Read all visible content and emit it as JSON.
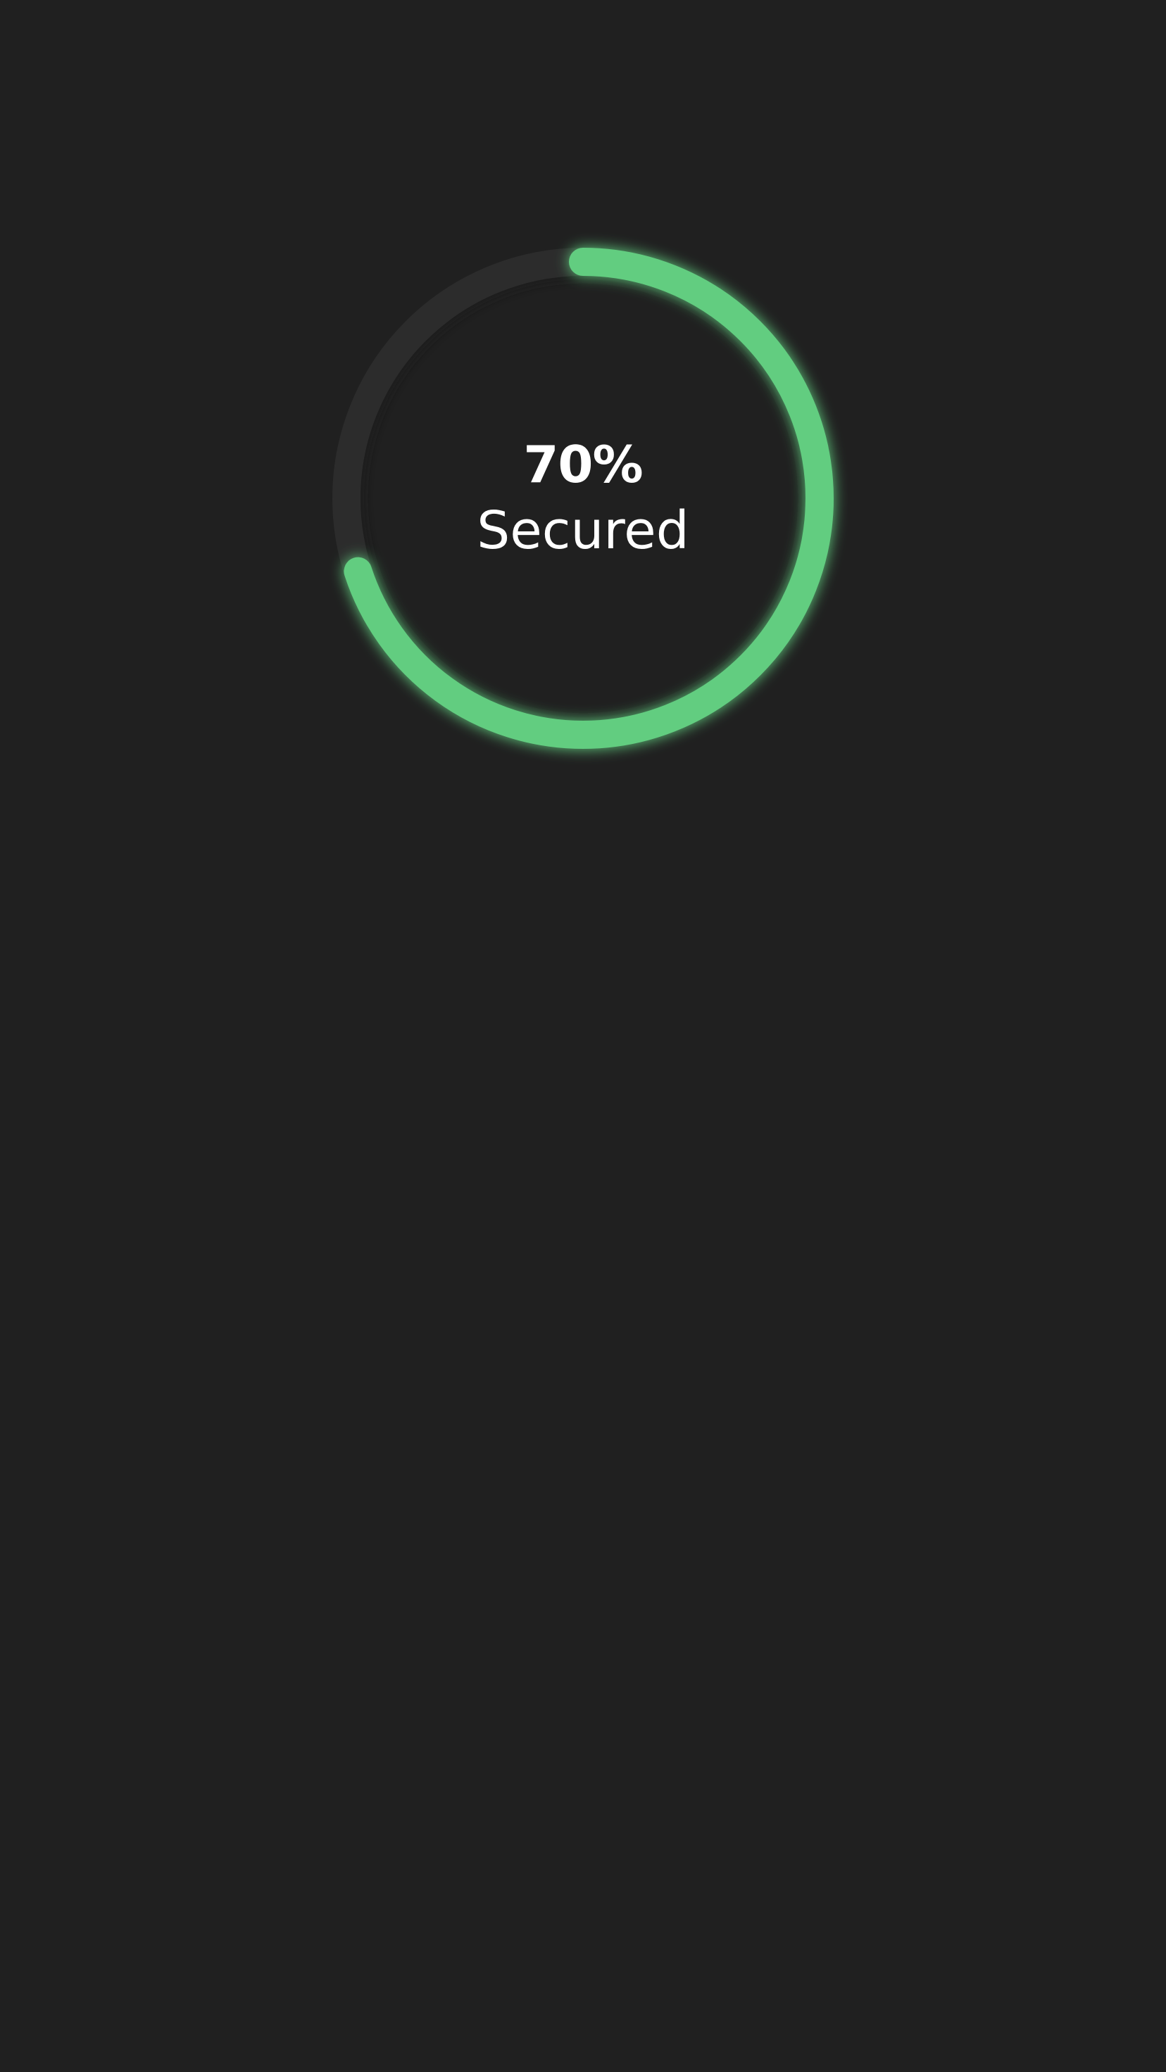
{
  "progress": {
    "value": 0.7,
    "value_label": "70%",
    "caption": "Secured"
  },
  "colors": {
    "background": "#202020",
    "track": "#2c2c2c",
    "progress": "#62cd80",
    "text": "#ffffff"
  }
}
